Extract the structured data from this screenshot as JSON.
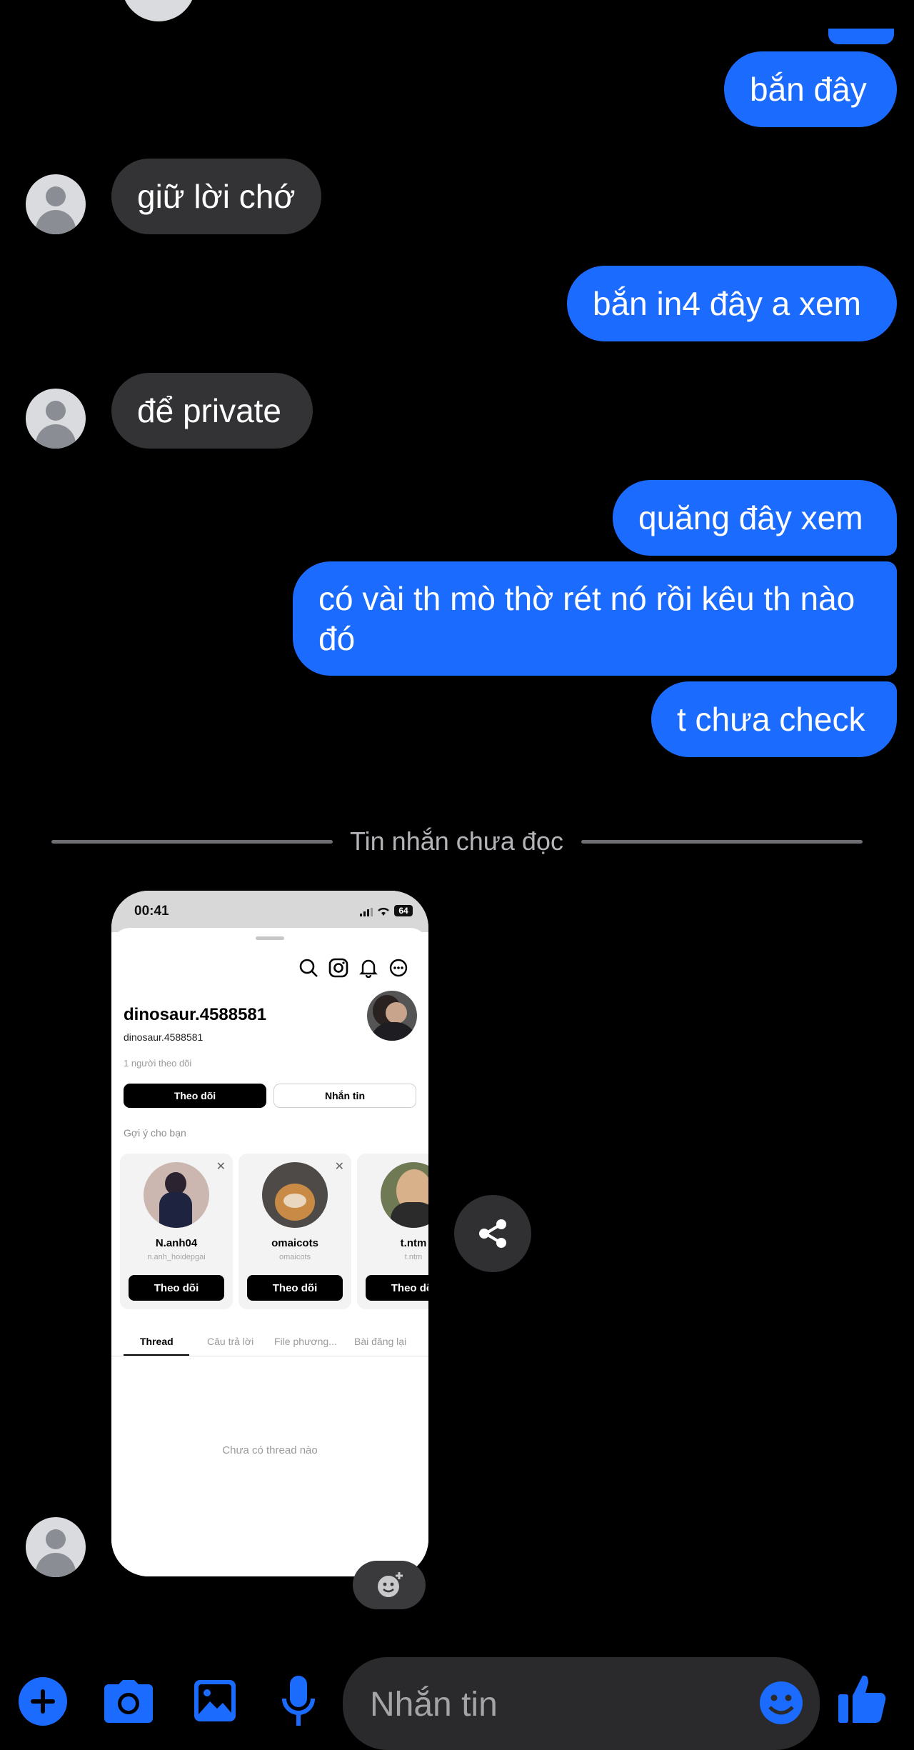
{
  "messages": [
    {
      "dir": "out",
      "text": "bắn đây"
    },
    {
      "dir": "in",
      "text": "giữ lời chớ"
    },
    {
      "dir": "out",
      "text": "bắn in4 đây a xem"
    },
    {
      "dir": "in",
      "text": "để private"
    },
    {
      "dir": "out",
      "text": "quăng đây xem"
    },
    {
      "dir": "out",
      "text": "có vài th mò thờ rét nó rồi kêu th nào",
      "text_line2": "đó"
    },
    {
      "dir": "out",
      "text": "t chưa check"
    }
  ],
  "unread_divider": "Tin nhắn chưa đọc",
  "shared_screenshot": {
    "status_time": "00:41",
    "battery": "64",
    "profile": {
      "name": "dinosaur.4588581",
      "handle": "dinosaur.4588581",
      "followers": "1 người theo dõi",
      "follow_button": "Theo dõi",
      "message_button": "Nhắn tin"
    },
    "suggestions_title": "Gợi ý cho bạn",
    "suggestions": [
      {
        "name": "N.anh04",
        "handle": "n.anh_hoidepgai",
        "button": "Theo dõi"
      },
      {
        "name": "omaicots",
        "handle": "omaicots",
        "button": "Theo dõi"
      },
      {
        "name": "t.ntm",
        "handle": "t.ntm",
        "button": "Theo dõi"
      }
    ],
    "tabs": [
      "Thread",
      "Câu trả lời",
      "File phương...",
      "Bài đăng lại"
    ],
    "empty_message": "Chưa có thread nào"
  },
  "composer": {
    "placeholder": "Nhắn tin"
  },
  "colors": {
    "accent": "#1c6bff",
    "outgoing_bubble": "#1c6bff",
    "incoming_bubble": "#333335",
    "background": "#000000"
  }
}
